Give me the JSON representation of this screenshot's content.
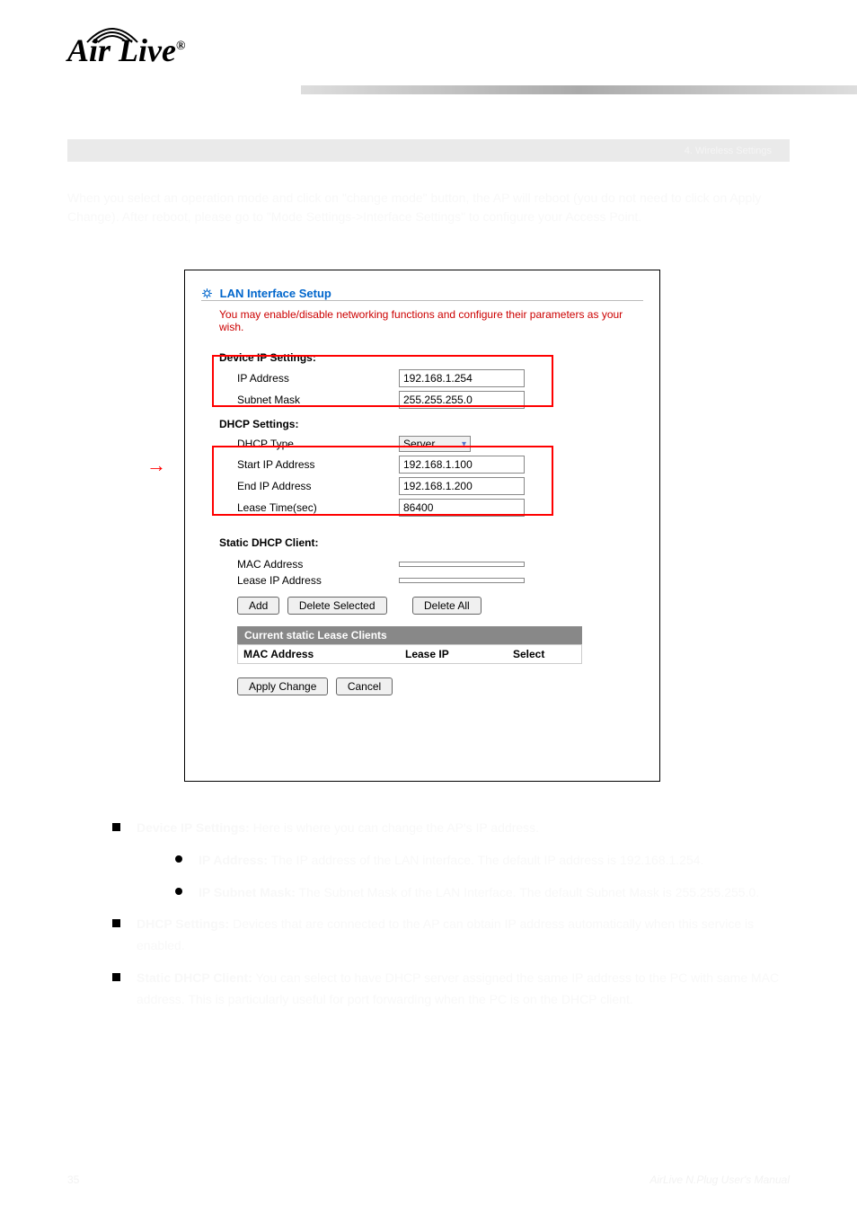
{
  "logo": {
    "text": "Air Live",
    "reg": "®"
  },
  "chapter": "4. Wireless Settings",
  "intro": "When you select an operation mode and click on \"change mode\" button, the AP will reboot (you do not need to click on Apply Change). After reboot, please go to \"Mode Settings->Interface Settings\" to configure your Access Point.",
  "screenshot": {
    "title": "LAN Interface Setup",
    "subtitle": "You may enable/disable networking functions and configure their parameters as your wish.",
    "device_group": "Device IP Settings:",
    "ip_label": "IP Address",
    "ip_value": "192.168.1.254",
    "subnet_label": "Subnet Mask",
    "subnet_value": "255.255.255.0",
    "dhcp_group": "DHCP Settings:",
    "dhcp_type_label": "DHCP Type",
    "dhcp_type_value": "Server",
    "start_label": "Start IP Address",
    "start_value": "192.168.1.100",
    "end_label": "End IP Address",
    "end_value": "192.168.1.200",
    "lease_label": "Lease Time(sec)",
    "lease_value": "86400",
    "static_group": "Static DHCP Client:",
    "mac_label": "MAC Address",
    "leaseip_label": "Lease IP Address",
    "add_btn": "Add",
    "delsel_btn": "Delete Selected",
    "delall_btn": "Delete All",
    "table_title": "Current static Lease Clients",
    "col1": "MAC Address",
    "col2": "Lease IP",
    "col3": "Select",
    "apply_btn": "Apply Change",
    "cancel_btn": "Cancel"
  },
  "b1": {
    "head": "Device IP Settings:",
    "body": "Here is where you can change the AP's IP address."
  },
  "sb1": {
    "head": "IP Address:",
    "body": "The IP address of the LAN interface. The default IP address is 192.168.1.254."
  },
  "sb2": {
    "head": "IP Subnet Mask:",
    "body": "The Subnet Mask of the LAN Interface. The default Subnet Mask is 255.255.255.0."
  },
  "b2": {
    "head": "DHCP Settings:",
    "body": "Devices that are connected to the AP can obtain IP address automatically when this service is enabled."
  },
  "b3": {
    "head": "Static DHCP Client:",
    "body": "You can select to have DHCP server assigned the same IP address to the PC with same MAC address. This is particularly useful for port forwarding when the PC is on the DHCP client."
  },
  "footer": {
    "page": "35",
    "manual": "AirLive N.Plug User's Manual"
  }
}
